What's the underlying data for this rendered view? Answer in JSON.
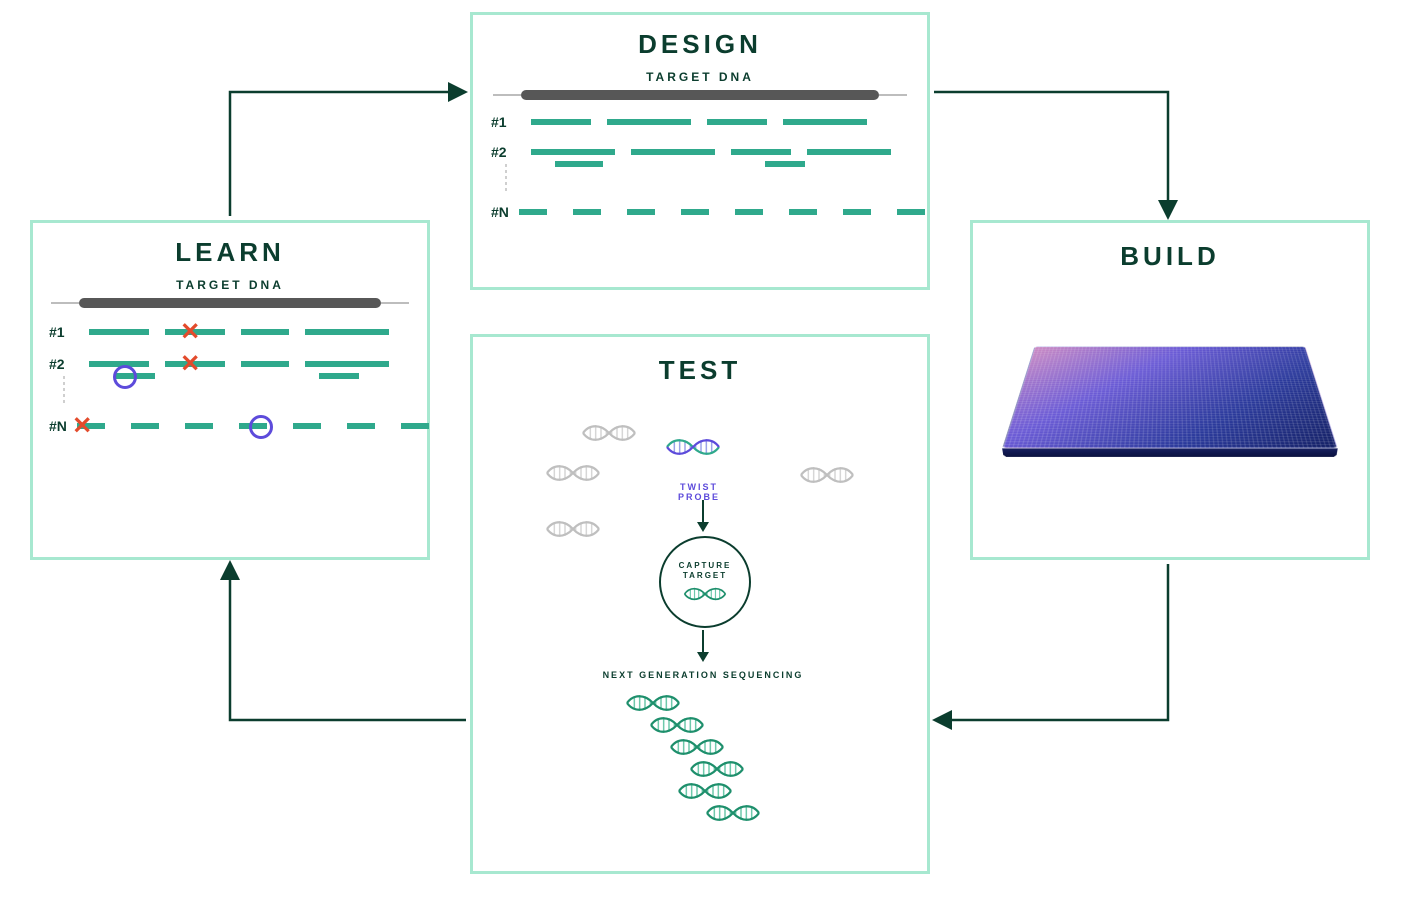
{
  "cycle": {
    "design": {
      "title": "DESIGN",
      "subtitle": "TARGET DNA",
      "rows": [
        "#1",
        "#2",
        "#N"
      ]
    },
    "build": {
      "title": "BUILD"
    },
    "test": {
      "title": "TEST",
      "probe_label": "TWIST PROBE",
      "capture_label": "CAPTURE\nTARGET",
      "ngs_label": "NEXT GENERATION SEQUENCING"
    },
    "learn": {
      "title": "LEARN",
      "subtitle": "TARGET DNA",
      "rows": [
        "#1",
        "#2",
        "#N"
      ]
    }
  },
  "colors": {
    "mint_border": "#a7e8d0",
    "teal": "#2fa98c",
    "dark_green": "#0b3d2e",
    "violet": "#5d4bdb",
    "red": "#e34b2c"
  }
}
